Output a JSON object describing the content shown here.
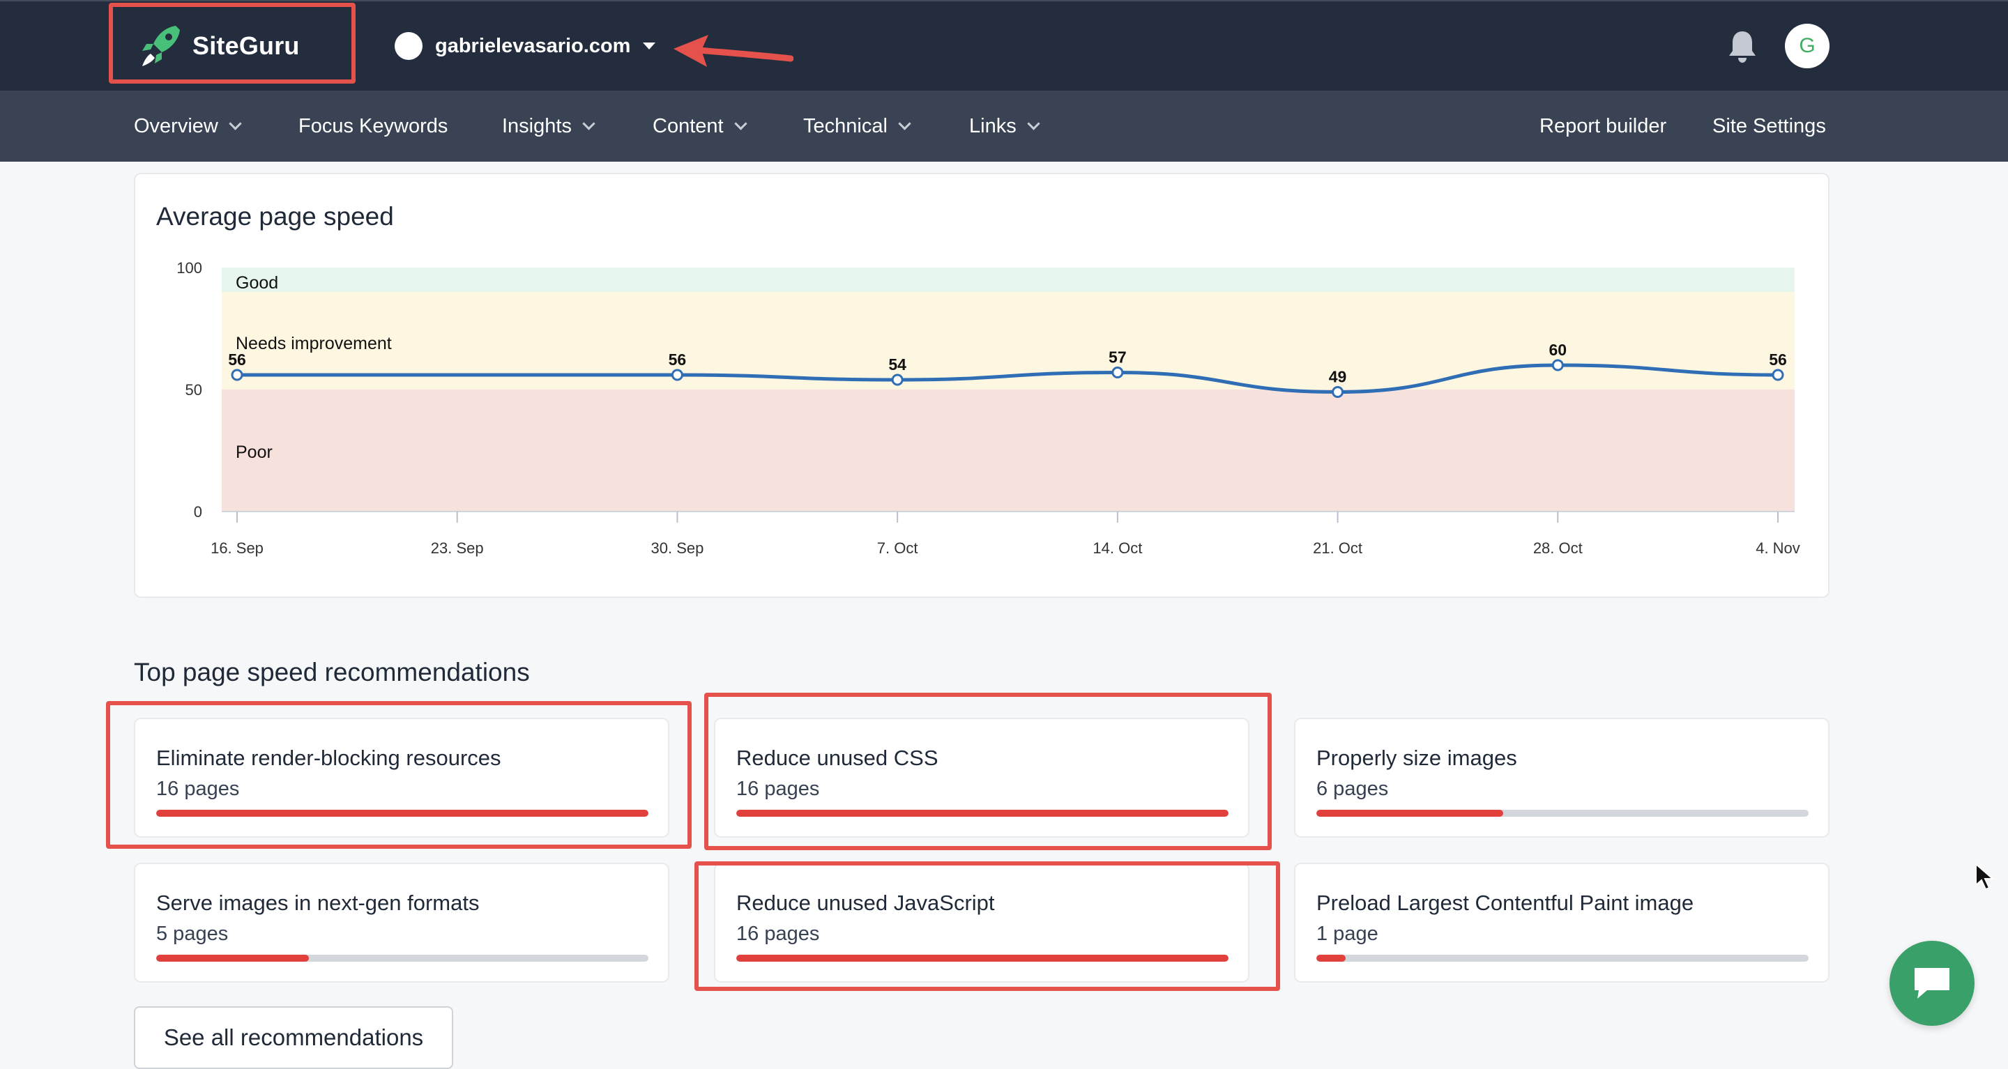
{
  "brand": {
    "name": "SiteGuru"
  },
  "site_switcher": {
    "domain": "gabrielevasario.com"
  },
  "user": {
    "avatar_initial": "G"
  },
  "nav": {
    "left": [
      {
        "label": "Overview",
        "dropdown": true
      },
      {
        "label": "Focus Keywords",
        "dropdown": false
      },
      {
        "label": "Insights",
        "dropdown": true
      },
      {
        "label": "Content",
        "dropdown": true
      },
      {
        "label": "Technical",
        "dropdown": true
      },
      {
        "label": "Links",
        "dropdown": true
      }
    ],
    "right": [
      {
        "label": "Report builder"
      },
      {
        "label": "Site Settings"
      }
    ]
  },
  "speed_section": {
    "title": "Average page speed"
  },
  "chart_data": {
    "type": "line",
    "title": "Average page speed",
    "ylim": [
      0,
      100
    ],
    "yticks": [
      0,
      50,
      100
    ],
    "bands": [
      {
        "label": "Good",
        "from": 90,
        "to": 100,
        "color": "#e6f6ec"
      },
      {
        "label": "Needs improvement",
        "from": 50,
        "to": 90,
        "color": "#fdf7e1"
      },
      {
        "label": "Poor",
        "from": 0,
        "to": 50,
        "color": "#f7e1dd"
      }
    ],
    "xticks": [
      "16. Sep",
      "23. Sep",
      "30. Sep",
      "7. Oct",
      "14. Oct",
      "21. Oct",
      "28. Oct",
      "4. Nov"
    ],
    "series": [
      {
        "color": "#2f6db5",
        "points": [
          {
            "x": "16. Sep",
            "y": 56
          },
          {
            "x": "30. Sep",
            "y": 56
          },
          {
            "x": "7. Oct",
            "y": 54
          },
          {
            "x": "14. Oct",
            "y": 57
          },
          {
            "x": "21. Oct",
            "y": 49
          },
          {
            "x": "28. Oct",
            "y": 60
          },
          {
            "x": "4. Nov",
            "y": 56
          }
        ]
      }
    ],
    "grid": false
  },
  "recommendations": {
    "title": "Top page speed recommendations",
    "items": [
      {
        "title": "Eliminate render-blocking resources",
        "pages": "16 pages",
        "fraction": 1.0
      },
      {
        "title": "Reduce unused CSS",
        "pages": "16 pages",
        "fraction": 1.0
      },
      {
        "title": "Properly size images",
        "pages": "6 pages",
        "fraction": 0.38
      },
      {
        "title": "Serve images in next-gen formats",
        "pages": "5 pages",
        "fraction": 0.31
      },
      {
        "title": "Reduce unused JavaScript",
        "pages": "16 pages",
        "fraction": 1.0
      },
      {
        "title": "Preload Largest Contentful Paint image",
        "pages": "1 page",
        "fraction": 0.06
      }
    ],
    "see_all_label": "See all recommendations"
  },
  "colors": {
    "topbar": "#242d3d",
    "navbar": "#394353",
    "accent_green": "#3aa06a",
    "progress_red": "#e2403c",
    "annotation_red": "#e5524b",
    "line_blue": "#2f6db5"
  },
  "icons": {
    "logo": "rocket-icon",
    "bell": "bell-icon",
    "chat": "chat-icon",
    "annotation": "arrow-icon"
  }
}
